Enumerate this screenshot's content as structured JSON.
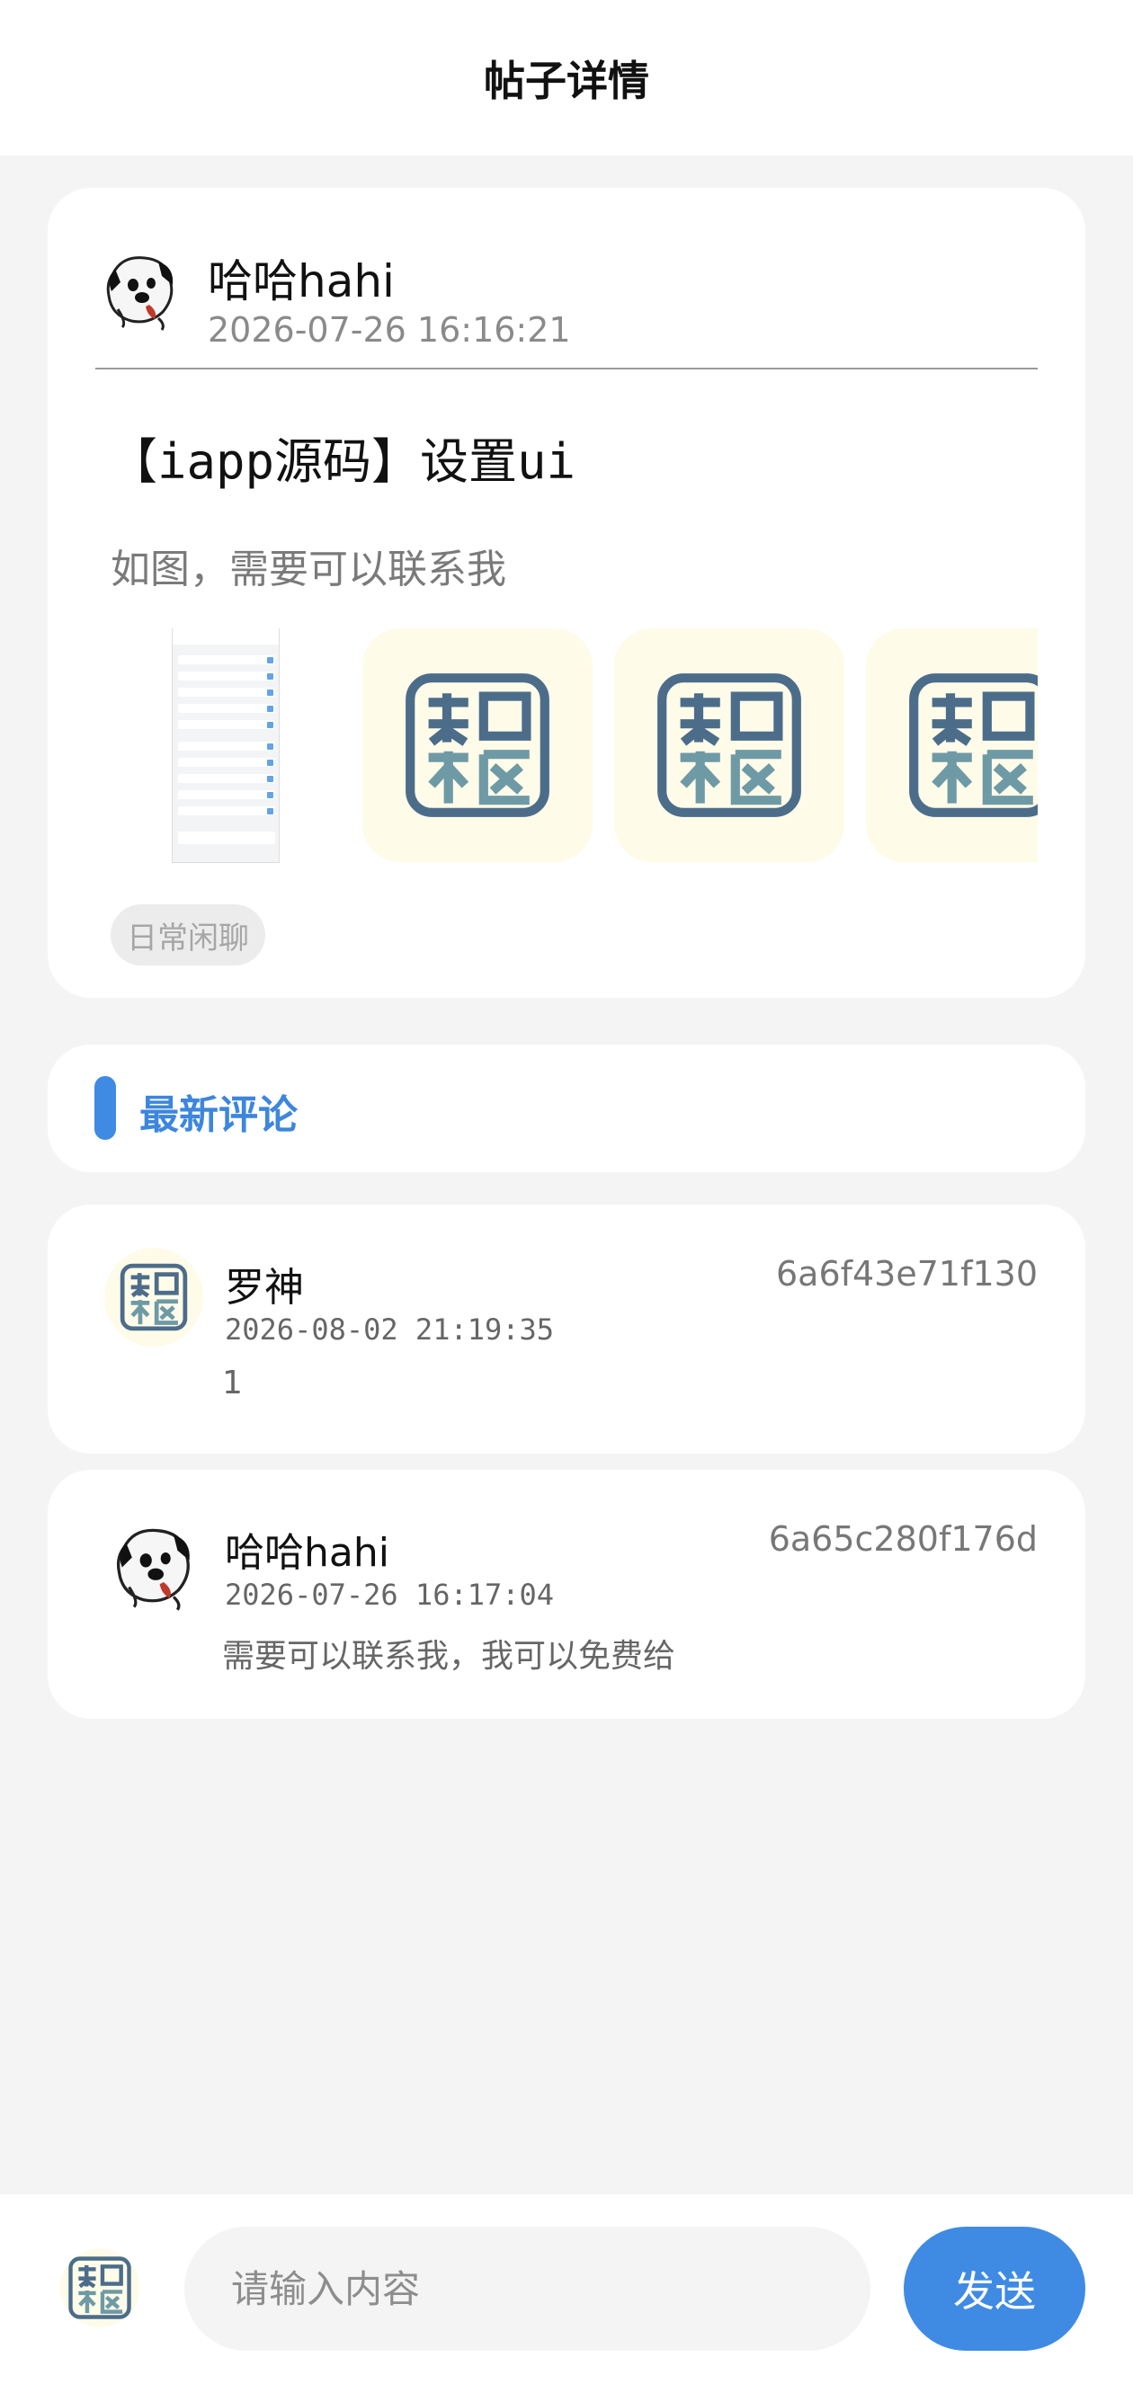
{
  "header": {
    "title": "帖子详情"
  },
  "post": {
    "author": "哈哈hahi",
    "time": "2026-07-26 16:16:21",
    "title": "【iapp源码】设置ui",
    "content": "如图，需要可以联系我",
    "tag": "日常闲聊",
    "images": [
      "app-screenshot",
      "app-logo",
      "app-logo",
      "app-logo"
    ]
  },
  "comments_section": {
    "title": "最新评论"
  },
  "comments": [
    {
      "name": "罗神",
      "time": "2026-08-02 21:19:35",
      "text": "1",
      "id": "6a6f43e71f130",
      "avatar": "app-logo"
    },
    {
      "name": "哈哈hahi",
      "time": "2026-07-26 16:17:04",
      "text": "需要可以联系我，我可以免费给",
      "id": "6a65c280f176d",
      "avatar": "dog-avatar"
    }
  ],
  "composer": {
    "placeholder": "请输入内容",
    "send_label": "发送"
  },
  "colors": {
    "accent": "#3f8be4",
    "logo_bg": "#fffbe9"
  }
}
